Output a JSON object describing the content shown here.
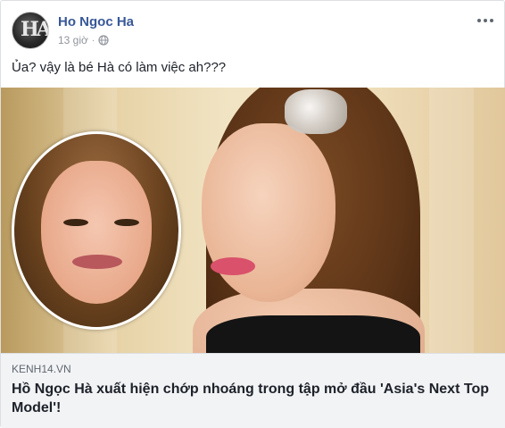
{
  "post": {
    "author": "Ho Ngoc Ha",
    "timestamp": "13 giờ",
    "privacy_icon": "globe-icon",
    "text": "Ủa? vậy là bé Hà có làm việc ah???",
    "more_icon": "more-horizontal-icon"
  },
  "link_preview": {
    "domain": "KENH14.VN",
    "title": "Hồ Ngọc Hà xuất hiện chớp nhoáng trong tập mở đầu 'Asia's Next Top Model'!"
  },
  "colors": {
    "author_link": "#385898",
    "meta_gray": "#90949c",
    "link_bg": "#f2f3f5",
    "border": "#dddfe2"
  }
}
